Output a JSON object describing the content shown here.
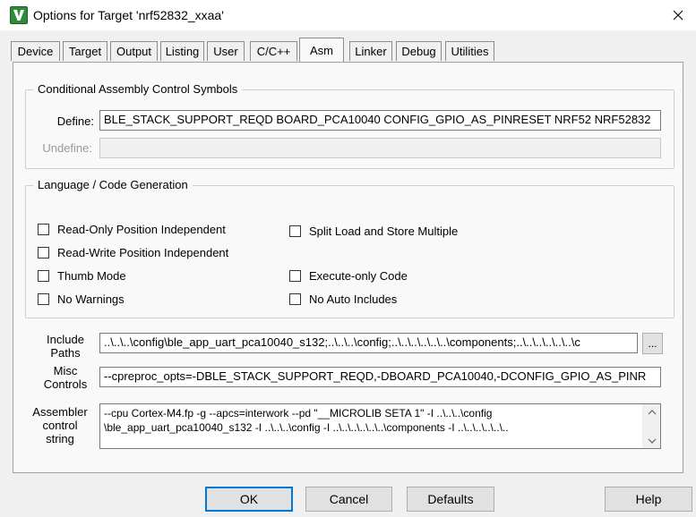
{
  "window": {
    "title": "Options for Target 'nrf52832_xxaa'",
    "app_icon": "keil-uvision-icon",
    "close_icon": "close-icon"
  },
  "tabs": [
    {
      "label": "Device"
    },
    {
      "label": "Target"
    },
    {
      "label": "Output"
    },
    {
      "label": "Listing"
    },
    {
      "label": "User"
    },
    {
      "label": "C/C++"
    },
    {
      "label": "Asm"
    },
    {
      "label": "Linker"
    },
    {
      "label": "Debug"
    },
    {
      "label": "Utilities"
    }
  ],
  "active_tab": "Asm",
  "conditional": {
    "title": "Conditional Assembly Control Symbols",
    "define_label": "Define:",
    "define_value": "BLE_STACK_SUPPORT_REQD BOARD_PCA10040 CONFIG_GPIO_AS_PINRESET NRF52 NRF52832",
    "undefine_label": "Undefine:",
    "undefine_value": ""
  },
  "language": {
    "title": "Language / Code Generation",
    "options": {
      "ropi": {
        "label": "Read-Only Position Independent",
        "checked": false
      },
      "rwpi": {
        "label": "Read-Write Position Independent",
        "checked": false
      },
      "thumb": {
        "label": "Thumb Mode",
        "checked": false
      },
      "no_warnings": {
        "label": "No Warnings",
        "checked": false
      },
      "split_ldm": {
        "label": "Split Load and Store Multiple",
        "checked": false
      },
      "execute_only": {
        "label": "Execute-only Code",
        "checked": false
      },
      "no_auto_includes": {
        "label": "No Auto Includes",
        "checked": false
      }
    }
  },
  "include_paths": {
    "label_line1": "Include",
    "label_line2": "Paths",
    "value": "..\\..\\..\\config\\ble_app_uart_pca10040_s132;..\\..\\..\\config;..\\..\\..\\..\\..\\..\\components;..\\..\\..\\..\\..\\..\\c",
    "browse_label": "..."
  },
  "misc_controls": {
    "label_line1": "Misc",
    "label_line2": "Controls",
    "value": "--cpreproc_opts=-DBLE_STACK_SUPPORT_REQD,-DBOARD_PCA10040,-DCONFIG_GPIO_AS_PINR"
  },
  "assembler_control": {
    "label_line1": "Assembler",
    "label_line2": "control",
    "label_line3": "string",
    "line1": "--cpu Cortex-M4.fp -g --apcs=interwork --pd \"__MICROLIB SETA 1\" -I ..\\..\\..\\config",
    "line2": "\\ble_app_uart_pca10040_s132 -I ..\\..\\..\\config -I ..\\..\\..\\..\\..\\..\\components -I ..\\..\\..\\..\\..\\.."
  },
  "buttons": {
    "ok": "OK",
    "cancel": "Cancel",
    "defaults": "Defaults",
    "help": "Help"
  },
  "colors": {
    "dialog_bg": "#f0f0f0",
    "panel_bg": "#f9f9f9",
    "default_button_border": "#0078d7",
    "icon_green": "#2e8b3a"
  }
}
